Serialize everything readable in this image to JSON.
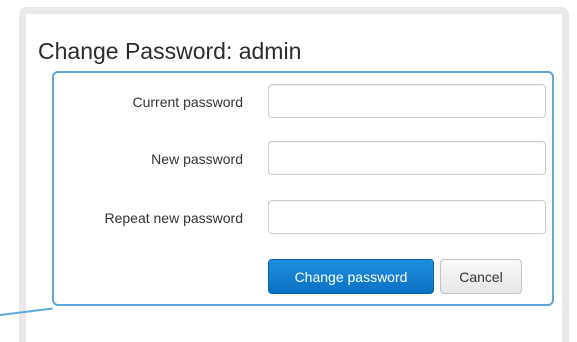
{
  "dialog": {
    "title": "Change Password: admin",
    "fields": [
      {
        "label": "Current password",
        "value": "",
        "placeholder": ""
      },
      {
        "label": "New password",
        "value": "",
        "placeholder": ""
      },
      {
        "label": "Repeat new password",
        "value": "",
        "placeholder": ""
      }
    ],
    "buttons": {
      "submit_label": "Change password",
      "cancel_label": "Cancel"
    }
  },
  "colors": {
    "accent": "#5ba7d9",
    "primary_button": "#1a82d2",
    "card_border": "#e9e9e9"
  }
}
